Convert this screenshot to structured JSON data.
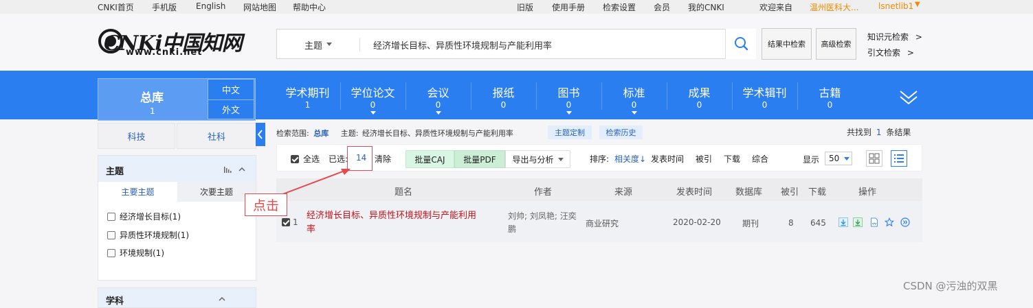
{
  "topbar": {
    "links": [
      "CNKI首页",
      "手机版",
      "English",
      "网站地图",
      "帮助中心"
    ],
    "right_links": [
      "旧版",
      "使用手册",
      "检索设置",
      "会员",
      "我的CNKI"
    ],
    "welcome": "欢迎来自",
    "institution": "温州医科大...",
    "user": "lsnetlib1"
  },
  "header": {
    "logo_text": "CNKi中国知网",
    "logo_url": "www.cnki.net",
    "search_field": "主题",
    "search_query": "经济增长目标、异质性环境规制与产能利用率",
    "btn_in_results": "结果中检索",
    "btn_advanced": "高级检索",
    "link_knowledge": "知识元检索",
    "link_citation": "引文检索",
    "arrow": ">"
  },
  "nav": {
    "zongku_label": "总库",
    "zongku_count": "1",
    "lang_cn": "中文",
    "lang_en": "外文",
    "items": [
      {
        "label": "学术期刊",
        "count": "1"
      },
      {
        "label": "学位论文",
        "count": "0"
      },
      {
        "label": "会议",
        "count": "0"
      },
      {
        "label": "报纸",
        "count": "0"
      },
      {
        "label": "图书",
        "count": "0"
      },
      {
        "label": "标准",
        "count": "0"
      },
      {
        "label": "成果",
        "count": "0"
      },
      {
        "label": "学术辑刊",
        "count": "0"
      },
      {
        "label": "古籍",
        "count": "0"
      }
    ]
  },
  "sidebar": {
    "tab_keji": "科技",
    "tab_sheke": "社科",
    "panel_title": "主题",
    "sub_main": "主要主题",
    "sub_second": "次要主题",
    "facets": [
      "经济增长目标(1)",
      "异质性环境规制(1)",
      "环境规制(1)"
    ],
    "panel2_title": "学科"
  },
  "results": {
    "scope_label": "检索范围:",
    "scope_value": "总库",
    "topic_label": "主题:",
    "topic_value": "经济增长目标、异质性环境规制与产能利用率",
    "btn_topic_custom": "主题定制",
    "btn_history": "检索历史",
    "found_prefix": "共找到",
    "found_count": "1",
    "found_suffix": "条结果"
  },
  "toolbar": {
    "select_all": "全选",
    "selected_label": "已选:",
    "selected_count": "14",
    "clear": "清除",
    "batch_caj": "批量CAJ",
    "batch_pdf": "批量PDF",
    "export": "导出与分析",
    "sort_label": "排序:",
    "sort_relevance": "相关度",
    "sort_date": "发表时间",
    "sort_cited": "被引",
    "sort_download": "下载",
    "sort_composite": "综合",
    "display_label": "显示",
    "display_value": "50"
  },
  "table": {
    "headers": [
      "题名",
      "作者",
      "来源",
      "发表时间",
      "数据库",
      "被引",
      "下载",
      "操作"
    ],
    "rows": [
      {
        "index": "1",
        "title_line1": "经济增长目标、异质性环境规制与产能利用",
        "title_line2": "率",
        "authors_line1": "刘帅; 刘凤艳; 汪奕",
        "authors_line2": "鹏",
        "source": "商业研究",
        "date": "2020-02-20",
        "database": "期刊",
        "cited": "8",
        "downloads": "645"
      }
    ]
  },
  "annotation": {
    "label": "点击"
  },
  "watermark": "CSDN @污浊的双黑",
  "colors": {
    "nav_blue": "#2b7ef0",
    "title_red": "#c0141a",
    "accent_orange": "#f08a00",
    "callout_red": "#e5484d",
    "caj_green": "#d9f5e3",
    "pdf_green": "#cdeed6"
  }
}
